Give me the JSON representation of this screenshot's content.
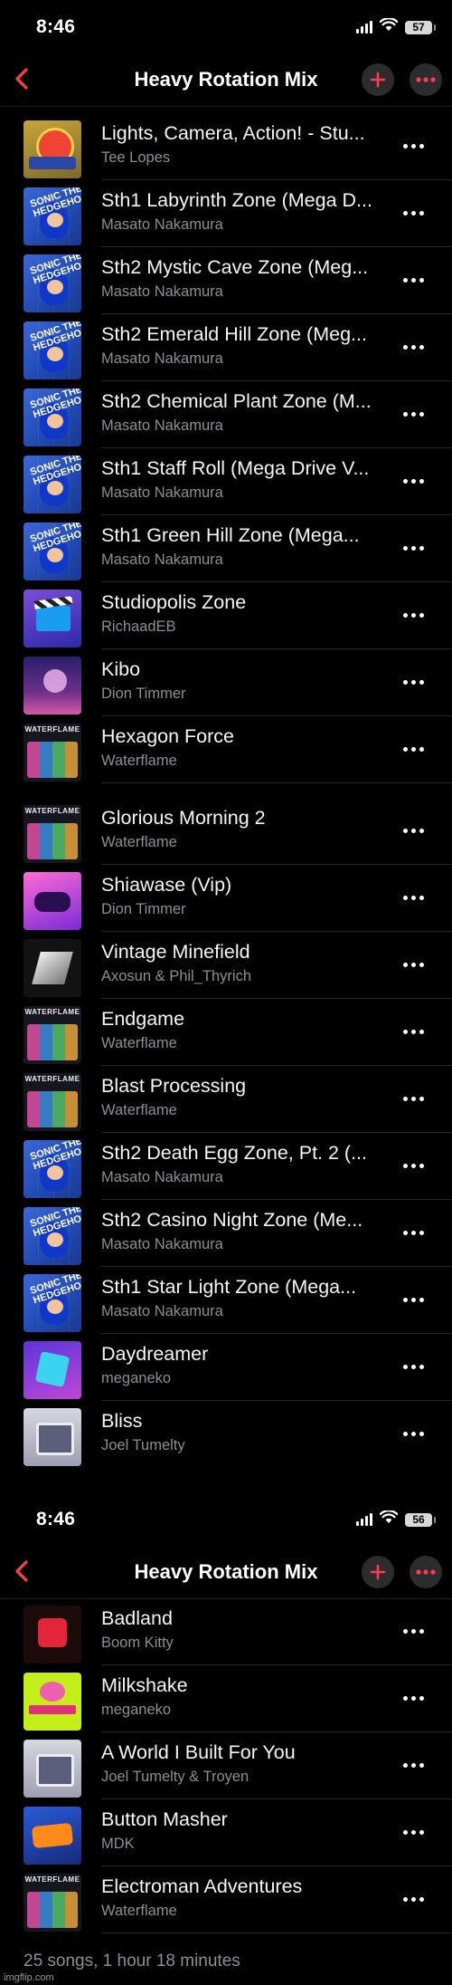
{
  "screens": [
    {
      "time": "8:46",
      "battery": "57",
      "title": "Heavy Rotation Mix"
    },
    {
      "time": "8:46",
      "battery": "56",
      "title": "Heavy Rotation Mix"
    }
  ],
  "songs": [
    {
      "title": "Lights, Camera, Action! - Stu...",
      "artist": "Tee Lopes",
      "art": "tee"
    },
    {
      "title": "Sth1 Labyrinth Zone (Mega D...",
      "artist": "Masato Nakamura",
      "art": "sonic"
    },
    {
      "title": "Sth2 Mystic Cave Zone (Meg...",
      "artist": "Masato Nakamura",
      "art": "sonic"
    },
    {
      "title": "Sth2 Emerald Hill Zone (Meg...",
      "artist": "Masato Nakamura",
      "art": "sonic"
    },
    {
      "title": "Sth2 Chemical Plant Zone (M...",
      "artist": "Masato Nakamura",
      "art": "sonic"
    },
    {
      "title": "Sth1 Staff Roll (Mega Drive V...",
      "artist": "Masato Nakamura",
      "art": "sonic"
    },
    {
      "title": "Sth1 Green Hill Zone (Mega...",
      "artist": "Masato Nakamura",
      "art": "sonic"
    },
    {
      "title": "Studiopolis Zone",
      "artist": "RichaadEB",
      "art": "studio"
    },
    {
      "title": "Kibo",
      "artist": "Dion Timmer",
      "art": "kibo"
    },
    {
      "title": "Hexagon Force",
      "artist": "Waterflame",
      "art": "water"
    },
    {
      "title": "Glorious Morning 2",
      "artist": "Waterflame",
      "art": "water"
    },
    {
      "title": "Shiawase (Vip)",
      "artist": "Dion Timmer",
      "art": "shia"
    },
    {
      "title": "Vintage Minefield",
      "artist": "Axosun & Phil_Thyrich",
      "art": "vint"
    },
    {
      "title": "Endgame",
      "artist": "Waterflame",
      "art": "water"
    },
    {
      "title": "Blast Processing",
      "artist": "Waterflame",
      "art": "water"
    },
    {
      "title": "Sth2 Death Egg Zone, Pt. 2 (...",
      "artist": "Masato Nakamura",
      "art": "sonic"
    },
    {
      "title": "Sth2 Casino Night Zone (Me...",
      "artist": "Masato Nakamura",
      "art": "sonic"
    },
    {
      "title": "Sth1 Star Light Zone (Mega...",
      "artist": "Masato Nakamura",
      "art": "sonic"
    },
    {
      "title": "Daydreamer",
      "artist": "meganeko",
      "art": "day"
    },
    {
      "title": "Bliss",
      "artist": "Joel Tumelty",
      "art": "bliss"
    },
    {
      "title": "Badland",
      "artist": "Boom Kitty",
      "art": "bad"
    },
    {
      "title": "Milkshake",
      "artist": "meganeko",
      "art": "milk"
    },
    {
      "title": "A World I Built For You",
      "artist": "Joel Tumelty & Troyen",
      "art": "bliss"
    },
    {
      "title": "Button Masher",
      "artist": "MDK",
      "art": "mdk"
    },
    {
      "title": "Electroman Adventures",
      "artist": "Waterflame",
      "art": "water"
    }
  ],
  "art_labels": {
    "waterflame": "WATERFLAME",
    "sonic": "SONIC THE HEDGEHOG"
  },
  "footer": "25 songs, 1 hour 18 minutes",
  "watermark": "imgflip.com",
  "colors": {
    "accent": "#ff3b4e",
    "secondary_text": "#8e8e93",
    "background": "#000000"
  }
}
